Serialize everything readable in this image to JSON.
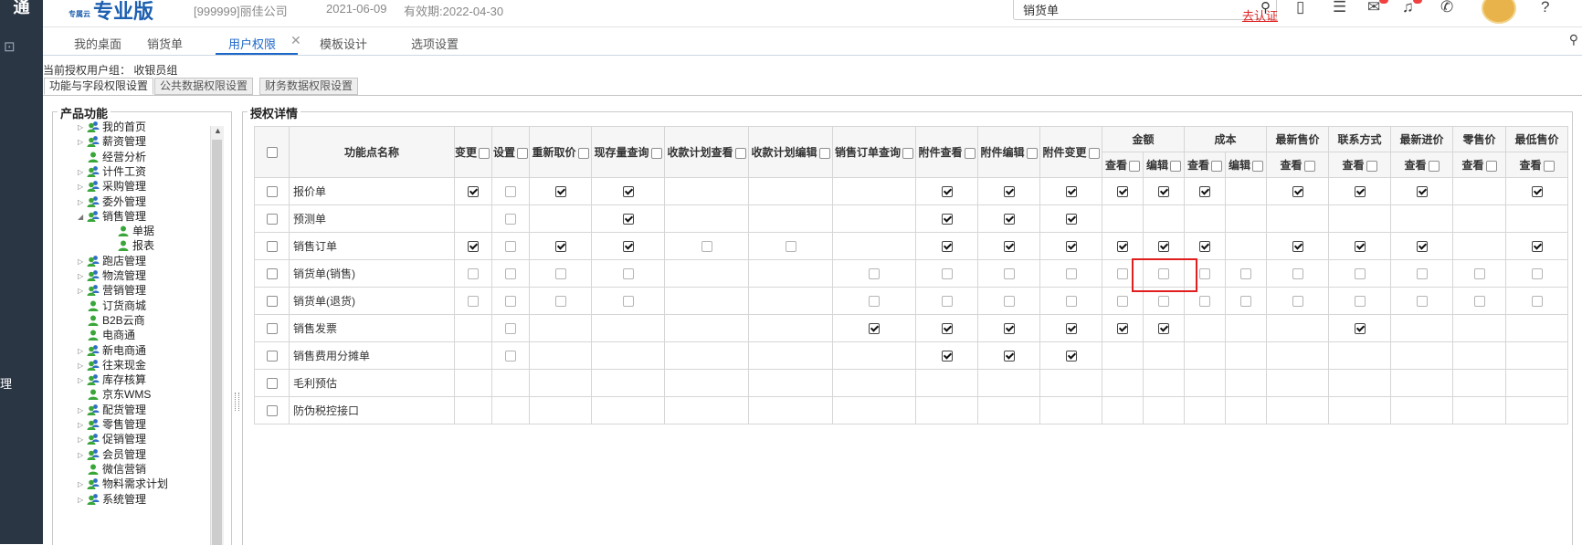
{
  "app": {
    "logo": "通",
    "brand_sub": "专属云",
    "brand": "专业版",
    "company": "[999999]丽佳公司",
    "date": "2021-06-09",
    "expiry": "有效期:2022-04-30",
    "search_value": "销货单",
    "auth_link": "去认证",
    "side_cut_text": "理"
  },
  "tabs": [
    {
      "label": "我的桌面",
      "active": false
    },
    {
      "label": "销货单",
      "active": false
    },
    {
      "label": "用户权限",
      "active": true
    },
    {
      "label": "模板设计",
      "active": false
    },
    {
      "label": "选项设置",
      "active": false
    }
  ],
  "page": {
    "group_label": "当前授权用户组：  收银员组",
    "subtabs": [
      "功能与字段权限设置",
      "公共数据权限设置",
      "财务数据权限设置"
    ],
    "left_legend": "产品功能",
    "right_legend": "授权详情"
  },
  "tree": [
    {
      "label": "我的首页",
      "arrow": "right",
      "icon": "group",
      "level": 0
    },
    {
      "label": "薪资管理",
      "arrow": "right",
      "icon": "group",
      "level": 0
    },
    {
      "label": "经营分析",
      "arrow": "none",
      "icon": "user",
      "level": 0
    },
    {
      "label": "计件工资",
      "arrow": "right",
      "icon": "group",
      "level": 0
    },
    {
      "label": "采购管理",
      "arrow": "right",
      "icon": "group",
      "level": 0
    },
    {
      "label": "委外管理",
      "arrow": "right",
      "icon": "group",
      "level": 0
    },
    {
      "label": "销售管理",
      "arrow": "down",
      "icon": "group",
      "level": 0
    },
    {
      "label": "单据",
      "arrow": "none",
      "icon": "user",
      "level": 1
    },
    {
      "label": "报表",
      "arrow": "none",
      "icon": "user",
      "level": 1
    },
    {
      "label": "跑店管理",
      "arrow": "right",
      "icon": "group",
      "level": 0
    },
    {
      "label": "物流管理",
      "arrow": "right",
      "icon": "group",
      "level": 0
    },
    {
      "label": "营销管理",
      "arrow": "right",
      "icon": "group",
      "level": 0
    },
    {
      "label": "订货商城",
      "arrow": "none",
      "icon": "user",
      "level": 0
    },
    {
      "label": "B2B云商",
      "arrow": "none",
      "icon": "user",
      "level": 0
    },
    {
      "label": "电商通",
      "arrow": "none",
      "icon": "user",
      "level": 0
    },
    {
      "label": "新电商通",
      "arrow": "right",
      "icon": "group",
      "level": 0
    },
    {
      "label": "往来现金",
      "arrow": "right",
      "icon": "group",
      "level": 0
    },
    {
      "label": "库存核算",
      "arrow": "right",
      "icon": "group",
      "level": 0
    },
    {
      "label": "京东WMS",
      "arrow": "none",
      "icon": "user",
      "level": 0
    },
    {
      "label": "配货管理",
      "arrow": "right",
      "icon": "group",
      "level": 0
    },
    {
      "label": "零售管理",
      "arrow": "right",
      "icon": "group",
      "level": 0
    },
    {
      "label": "促销管理",
      "arrow": "right",
      "icon": "group",
      "level": 0
    },
    {
      "label": "会员管理",
      "arrow": "right",
      "icon": "group",
      "level": 0
    },
    {
      "label": "微信营销",
      "arrow": "none",
      "icon": "user",
      "level": 0
    },
    {
      "label": "物料需求计划",
      "arrow": "right",
      "icon": "group",
      "level": 0
    },
    {
      "label": "系统管理",
      "arrow": "right",
      "icon": "group",
      "level": 0
    }
  ],
  "grid": {
    "header_name": "功能点名称",
    "single_cols": [
      {
        "label": "变更",
        "checkbox": true
      },
      {
        "label": "设置",
        "checkbox": true
      },
      {
        "label": "重新取价",
        "checkbox": true
      },
      {
        "label": "现存量查询",
        "checkbox": true
      },
      {
        "label": "收款计划查看",
        "checkbox": true
      },
      {
        "label": "收款计划编辑",
        "checkbox": true
      },
      {
        "label": "销售订单查询",
        "checkbox": true
      },
      {
        "label": "附件查看",
        "checkbox": true
      },
      {
        "label": "附件编辑",
        "checkbox": true
      },
      {
        "label": "附件变更",
        "checkbox": true
      }
    ],
    "groups": [
      {
        "label": "金额",
        "subs": [
          "查看",
          "编辑"
        ]
      },
      {
        "label": "成本",
        "subs": [
          "查看",
          "编辑"
        ]
      },
      {
        "label": "最新售价",
        "subs": [
          "查看"
        ]
      },
      {
        "label": "联系方式",
        "subs": [
          "查看"
        ]
      },
      {
        "label": "最新进价",
        "subs": [
          "查看"
        ]
      },
      {
        "label": "零售价",
        "subs": [
          "查看"
        ]
      },
      {
        "label": "最低售价",
        "subs": [
          "查看"
        ]
      }
    ],
    "rows": [
      {
        "name": "报价单",
        "cells": [
          "C",
          "E",
          "C",
          "C",
          "N",
          "N",
          "N",
          "C",
          "C",
          "C",
          "C",
          "C",
          "C",
          "N",
          "C",
          "C",
          "C",
          "N",
          "C"
        ]
      },
      {
        "name": "预测单",
        "cells": [
          "N",
          "E",
          "N",
          "C",
          "N",
          "N",
          "N",
          "C",
          "C",
          "C",
          "N",
          "N",
          "N",
          "N",
          "N",
          "N",
          "N",
          "N",
          "N"
        ]
      },
      {
        "name": "销售订单",
        "cells": [
          "C",
          "E",
          "C",
          "C",
          "E",
          "E",
          "N",
          "C",
          "C",
          "C",
          "C",
          "C",
          "C",
          "N",
          "C",
          "C",
          "C",
          "N",
          "C"
        ]
      },
      {
        "name": "销货单(销售)",
        "cells": [
          "E",
          "E",
          "E",
          "E",
          "N",
          "N",
          "E",
          "E",
          "E",
          "E",
          "E",
          "E",
          "E",
          "E",
          "E",
          "E",
          "E",
          "E",
          "E"
        ]
      },
      {
        "name": "销货单(退货)",
        "cells": [
          "E",
          "E",
          "E",
          "E",
          "N",
          "N",
          "E",
          "E",
          "E",
          "E",
          "E",
          "E",
          "E",
          "E",
          "E",
          "E",
          "E",
          "E",
          "E"
        ]
      },
      {
        "name": "销售发票",
        "cells": [
          "N",
          "E",
          "N",
          "N",
          "N",
          "N",
          "C",
          "C",
          "C",
          "C",
          "C",
          "C",
          "N",
          "N",
          "N",
          "C",
          "N",
          "N",
          "N"
        ]
      },
      {
        "name": "销售费用分摊单",
        "cells": [
          "N",
          "E",
          "N",
          "N",
          "N",
          "N",
          "N",
          "C",
          "C",
          "C",
          "N",
          "N",
          "N",
          "N",
          "N",
          "N",
          "N",
          "N",
          "N"
        ]
      },
      {
        "name": "毛利预估",
        "cells": [
          "N",
          "N",
          "N",
          "N",
          "N",
          "N",
          "N",
          "N",
          "N",
          "N",
          "N",
          "N",
          "N",
          "N",
          "N",
          "N",
          "N",
          "N",
          "N"
        ]
      },
      {
        "name": "防伪税控接口",
        "cells": [
          "N",
          "N",
          "N",
          "N",
          "N",
          "N",
          "N",
          "N",
          "N",
          "N",
          "N",
          "N",
          "N",
          "N",
          "N",
          "N",
          "N",
          "N",
          "N"
        ]
      }
    ]
  }
}
